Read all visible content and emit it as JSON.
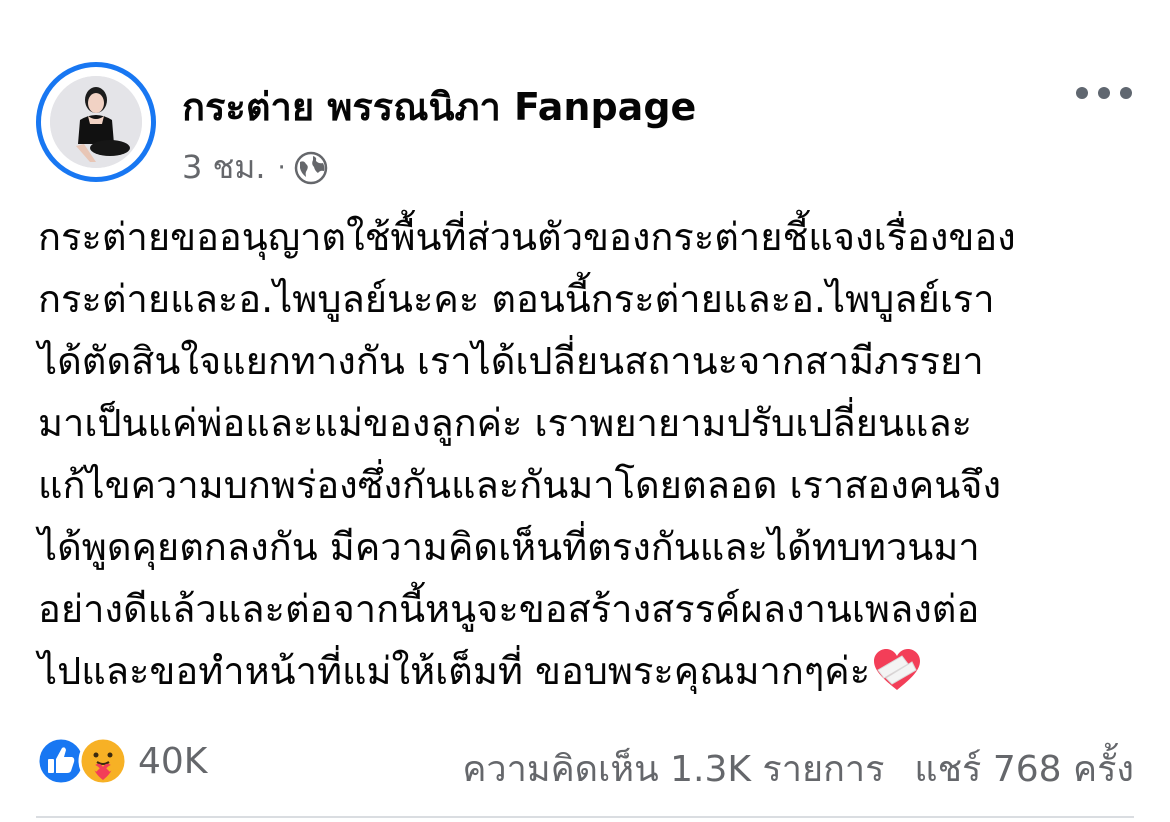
{
  "post": {
    "page_name": "กระต่าย พรรณนิภา Fanpage",
    "time": "3 ชม.",
    "separator": "·",
    "privacy_icon": "globe-icon",
    "more_icon": "more-dots-icon",
    "text_lines": [
      "กระต่ายขออนุญาตใช้พื้นที่ส่วนตัวของกระต่ายชี้แจงเรื่องของ",
      "กระต่ายและอ.ไพบูลย์นะคะ ตอนนี้กระต่ายและอ.ไพบูลย์เรา",
      "ได้ตัดสินใจแยกทางกัน เราได้เปลี่ยนสถานะจากสามีภรรยา",
      "มาเป็นแค่พ่อและแม่ของลูกค่ะ เราพยายามปรับเปลี่ยนและ",
      "แก้ไขความบกพร่องซึ่งกันและกันมาโดยตลอด เราสองคนจึง",
      "ได้พูดคุยตกลงกัน มีความคิดเห็นที่ตรงกันและได้ทบทวนมา",
      "อย่างดีแล้วและต่อจากนี้หนูจะขอสร้างสรรค์ผลงานเพลงต่อ",
      "ไปและขอทำหน้าที่แม่ให้เต็มที่ ขอบพระคุณมากๆค่ะ"
    ],
    "end_emoji": "mending-heart-icon"
  },
  "stats": {
    "reaction_icons": [
      "like-icon",
      "care-icon"
    ],
    "reactions": "40K",
    "comments": "ความคิดเห็น 1.3K รายการ",
    "shares": "แชร์ 768 ครั้ง"
  },
  "colors": {
    "accent": "#1877f2",
    "secondary_text": "#65676b",
    "like": "#1877f2",
    "care": "#f7b125",
    "heart": "#f33e58"
  }
}
